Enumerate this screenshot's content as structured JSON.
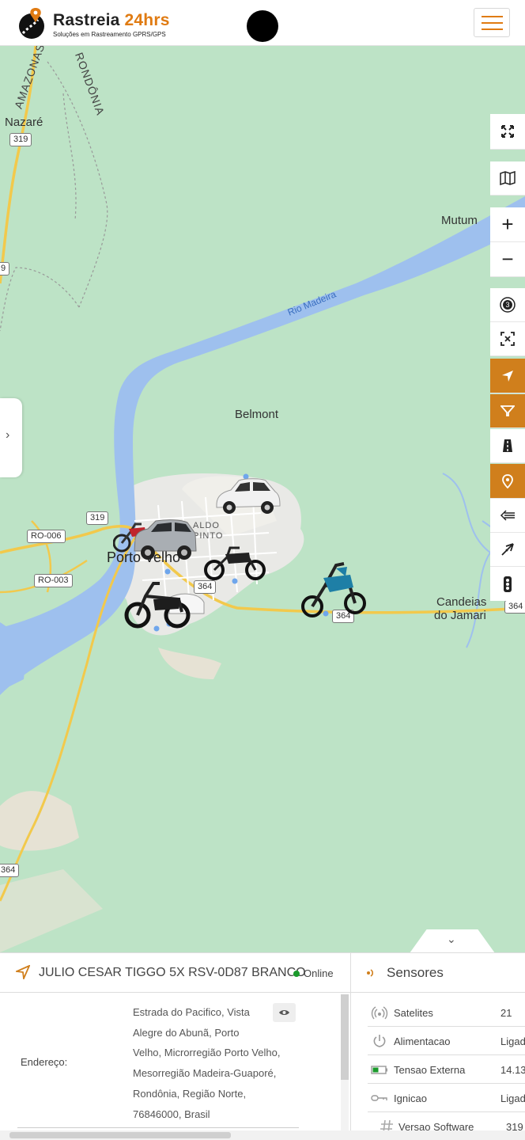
{
  "header": {
    "brand_name": "Rastreia",
    "brand_accent": "24hrs",
    "tagline": "Soluções em Rastreamento GPRS/GPS",
    "logo_icon": "map-pin-road-logo",
    "menu_icon": "hamburger-icon",
    "accent_color": "#e07b12"
  },
  "map": {
    "labels": {
      "amazonas": "AMAZONAS",
      "rondonia": "RONDÔNIA",
      "nazare": "Nazaré",
      "mutum": "Mutum",
      "rio_madeira": "Rio Madeira",
      "belmont": "Belmont",
      "porto_velho": "Porto Velho",
      "aldo_pinto": "ALDO PINTO",
      "candeias_1": "Candeias",
      "candeias_2": "do Jamari"
    },
    "shields": {
      "br319_top": "319",
      "br319_left": "9",
      "br319_mid": "319",
      "ro006": "RO-006",
      "ro003": "RO-003",
      "br364_a": "364",
      "br364_b": "364",
      "br364_c": "364",
      "br364_d": "364"
    },
    "controls": [
      {
        "name": "fullscreen-icon",
        "orange": false
      },
      {
        "name": "map-layers-icon",
        "orange": false
      },
      {
        "name": "zoom-in-icon",
        "orange": false
      },
      {
        "name": "zoom-out-icon",
        "orange": false
      },
      {
        "name": "cluster-count-icon",
        "orange": false
      },
      {
        "name": "fit-bounds-icon",
        "orange": false
      },
      {
        "name": "navigation-arrow-icon",
        "orange": true
      },
      {
        "name": "filter-funnel-icon",
        "orange": true
      },
      {
        "name": "road-icon",
        "orange": false
      },
      {
        "name": "location-pin-icon",
        "orange": true
      },
      {
        "name": "route-history-icon",
        "orange": false
      },
      {
        "name": "send-command-icon",
        "orange": false
      },
      {
        "name": "traffic-light-icon",
        "orange": false
      }
    ],
    "controls_text": {
      "zoom_in": "+",
      "zoom_out": "−",
      "cluster": "3"
    },
    "vehicles": [
      "car-white-suv",
      "motorcycle-red",
      "car-silver-hatch",
      "motorcycle-black",
      "scooter-black",
      "motorcycle-blue"
    ]
  },
  "panel": {
    "vehicle_name": "JULIO CESAR TIGGO 5X RSV-0D87 BRANCO",
    "status": "Online",
    "status_color": "#1a9a2b",
    "address_label": "Endereço:",
    "address_lines": [
      "Estrada do Pacifico, Vista",
      "Alegre do Abunã, Porto",
      "Velho, Microrregião Porto Velho,",
      "Mesorregião Madeira-Guaporé,",
      "Rondônia, Região Norte,",
      "76846000, Brasil"
    ],
    "sensors_title": "Sensores",
    "sensors": [
      {
        "name": "Satelites",
        "value": "21",
        "icon": "satellite-signal-icon"
      },
      {
        "name": "Alimentacao",
        "value": "Ligad",
        "icon": "power-icon"
      },
      {
        "name": "Tensao Externa",
        "value": "14.13",
        "icon": "battery-icon"
      },
      {
        "name": "Ignicao",
        "value": "Ligad",
        "icon": "ignition-key-icon"
      },
      {
        "name": "Versao Software",
        "value": "319",
        "icon": "hash-icon"
      }
    ]
  }
}
